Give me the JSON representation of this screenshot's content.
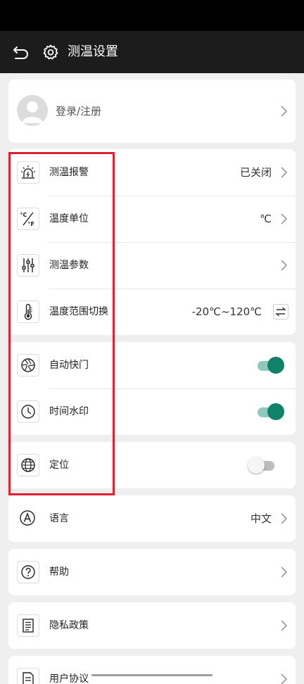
{
  "header": {
    "title": "测温设置",
    "back_icon": "back-arrow-icon",
    "settings_icon": "gear-icon"
  },
  "account": {
    "label": "登录/注册",
    "avatar_icon": "user-avatar-icon"
  },
  "measurement": {
    "items": [
      {
        "label": "测温报警",
        "value": "已关闭",
        "icon": "alarm-light-icon"
      },
      {
        "label": "温度单位",
        "value": "℃",
        "icon": "celsius-fahrenheit-icon"
      },
      {
        "label": "测温参数",
        "value": "",
        "icon": "sliders-icon"
      },
      {
        "label": "温度范围切换",
        "value": "-20℃~120℃",
        "icon": "thermometer-icon"
      }
    ]
  },
  "camera": {
    "items": [
      {
        "label": "自动快门",
        "state": "on",
        "icon": "shutter-icon"
      },
      {
        "label": "时间水印",
        "state": "on",
        "icon": "clock-icon"
      }
    ]
  },
  "location": {
    "label": "定位",
    "state": "off",
    "icon": "globe-icon"
  },
  "language": {
    "label": "语言",
    "value": "中文",
    "icon": "language-icon"
  },
  "help": {
    "label": "帮助",
    "icon": "help-icon"
  },
  "privacy": {
    "label": "隐私政策",
    "icon": "document-icon"
  },
  "agreement": {
    "label": "用户协议",
    "icon": "agreement-icon"
  },
  "colors": {
    "toggle_on": "#10826a",
    "toggle_track_on": "#8fc8be",
    "highlight": "#e0202e",
    "appbar": "#1c1c1c"
  }
}
